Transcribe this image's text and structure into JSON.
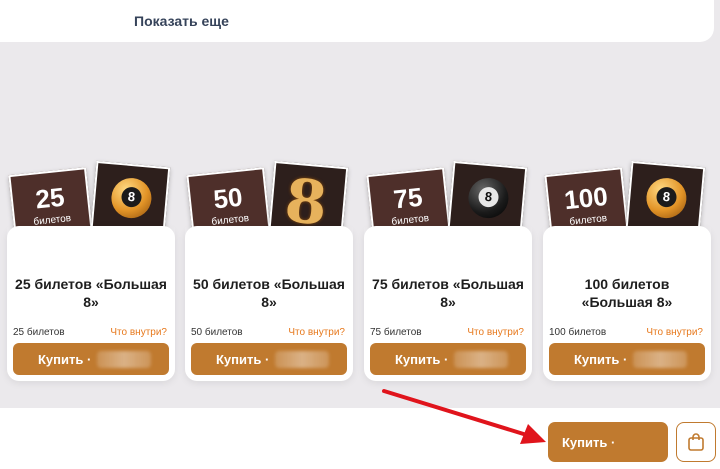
{
  "show_more": {
    "label": "Показать еще"
  },
  "cards": [
    {
      "ticket_number": "25",
      "ticket_word": "билетов",
      "title": "25 билетов «Большая 8»",
      "count": "25 билетов",
      "inside": "Что внутри?",
      "buy": "Купить ·",
      "ball_style": "gold"
    },
    {
      "ticket_number": "50",
      "ticket_word": "билетов",
      "title": "50 билетов «Большая 8»",
      "count": "50 билетов",
      "inside": "Что внутри?",
      "buy": "Купить ·",
      "ball_style": "big-eight"
    },
    {
      "ticket_number": "75",
      "ticket_word": "билетов",
      "title": "75 билетов «Большая 8»",
      "count": "75 билетов",
      "inside": "Что внутри?",
      "buy": "Купить ·",
      "ball_style": "dark"
    },
    {
      "ticket_number": "100",
      "ticket_word": "билетов",
      "title": "100 билетов «Большая 8»",
      "count": "100 билетов",
      "inside": "Что внутри?",
      "buy": "Купить ·",
      "ball_style": "gold"
    }
  ],
  "bottom": {
    "buy_label": "Купить ·",
    "cart_icon": "shopping-bag-icon"
  },
  "colors": {
    "accent": "#c07a2f",
    "link": "#e7791d",
    "ticket_bg": "#4e2f2a",
    "arrow": "#e0141c"
  }
}
